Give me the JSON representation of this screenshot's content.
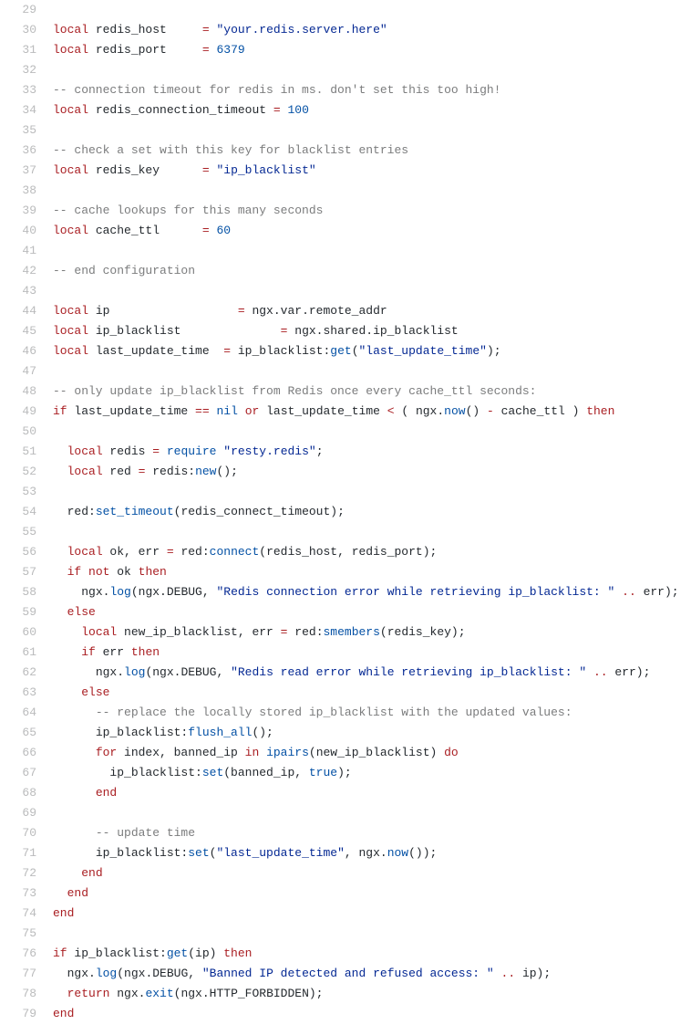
{
  "lines": [
    {
      "n": 29,
      "tokens": []
    },
    {
      "n": 30,
      "tokens": [
        {
          "c": "kw",
          "t": "local"
        },
        {
          "c": "pl",
          "t": " redis_host     "
        },
        {
          "c": "kw",
          "t": "="
        },
        {
          "c": "pl",
          "t": " "
        },
        {
          "c": "str",
          "t": "\"your.redis.server.here\""
        }
      ]
    },
    {
      "n": 31,
      "tokens": [
        {
          "c": "kw",
          "t": "local"
        },
        {
          "c": "pl",
          "t": " redis_port     "
        },
        {
          "c": "kw",
          "t": "="
        },
        {
          "c": "pl",
          "t": " "
        },
        {
          "c": "num",
          "t": "6379"
        }
      ]
    },
    {
      "n": 32,
      "tokens": []
    },
    {
      "n": 33,
      "tokens": [
        {
          "c": "com",
          "t": "-- connection timeout for redis in ms. don't set this too high!"
        }
      ]
    },
    {
      "n": 34,
      "tokens": [
        {
          "c": "kw",
          "t": "local"
        },
        {
          "c": "pl",
          "t": " redis_connection_timeout "
        },
        {
          "c": "kw",
          "t": "="
        },
        {
          "c": "pl",
          "t": " "
        },
        {
          "c": "num",
          "t": "100"
        }
      ]
    },
    {
      "n": 35,
      "tokens": []
    },
    {
      "n": 36,
      "tokens": [
        {
          "c": "com",
          "t": "-- check a set with this key for blacklist entries"
        }
      ]
    },
    {
      "n": 37,
      "tokens": [
        {
          "c": "kw",
          "t": "local"
        },
        {
          "c": "pl",
          "t": " redis_key      "
        },
        {
          "c": "kw",
          "t": "="
        },
        {
          "c": "pl",
          "t": " "
        },
        {
          "c": "str",
          "t": "\"ip_blacklist\""
        }
      ]
    },
    {
      "n": 38,
      "tokens": []
    },
    {
      "n": 39,
      "tokens": [
        {
          "c": "com",
          "t": "-- cache lookups for this many seconds"
        }
      ]
    },
    {
      "n": 40,
      "tokens": [
        {
          "c": "kw",
          "t": "local"
        },
        {
          "c": "pl",
          "t": " cache_ttl      "
        },
        {
          "c": "kw",
          "t": "="
        },
        {
          "c": "pl",
          "t": " "
        },
        {
          "c": "num",
          "t": "60"
        }
      ]
    },
    {
      "n": 41,
      "tokens": []
    },
    {
      "n": 42,
      "tokens": [
        {
          "c": "com",
          "t": "-- end configuration"
        }
      ]
    },
    {
      "n": 43,
      "tokens": []
    },
    {
      "n": 44,
      "tokens": [
        {
          "c": "kw",
          "t": "local"
        },
        {
          "c": "pl",
          "t": " ip                  "
        },
        {
          "c": "kw",
          "t": "="
        },
        {
          "c": "pl",
          "t": " ngx.var.remote_addr"
        }
      ]
    },
    {
      "n": 45,
      "tokens": [
        {
          "c": "kw",
          "t": "local"
        },
        {
          "c": "pl",
          "t": " ip_blacklist              "
        },
        {
          "c": "kw",
          "t": "="
        },
        {
          "c": "pl",
          "t": " ngx.shared.ip_blacklist"
        }
      ]
    },
    {
      "n": 46,
      "tokens": [
        {
          "c": "kw",
          "t": "local"
        },
        {
          "c": "pl",
          "t": " last_update_time  "
        },
        {
          "c": "kw",
          "t": "="
        },
        {
          "c": "pl",
          "t": " ip_blacklist:"
        },
        {
          "c": "fn",
          "t": "get"
        },
        {
          "c": "pl",
          "t": "("
        },
        {
          "c": "str",
          "t": "\"last_update_time\""
        },
        {
          "c": "pl",
          "t": ");"
        }
      ]
    },
    {
      "n": 47,
      "tokens": []
    },
    {
      "n": 48,
      "tokens": [
        {
          "c": "com",
          "t": "-- only update ip_blacklist from Redis once every cache_ttl seconds:"
        }
      ]
    },
    {
      "n": 49,
      "tokens": [
        {
          "c": "kw",
          "t": "if"
        },
        {
          "c": "pl",
          "t": " last_update_time "
        },
        {
          "c": "kw",
          "t": "=="
        },
        {
          "c": "pl",
          "t": " "
        },
        {
          "c": "bool",
          "t": "nil"
        },
        {
          "c": "pl",
          "t": " "
        },
        {
          "c": "kw",
          "t": "or"
        },
        {
          "c": "pl",
          "t": " last_update_time "
        },
        {
          "c": "kw",
          "t": "<"
        },
        {
          "c": "pl",
          "t": " ( ngx."
        },
        {
          "c": "fn",
          "t": "now"
        },
        {
          "c": "pl",
          "t": "() "
        },
        {
          "c": "kw",
          "t": "-"
        },
        {
          "c": "pl",
          "t": " cache_ttl ) "
        },
        {
          "c": "kw",
          "t": "then"
        }
      ]
    },
    {
      "n": 50,
      "tokens": []
    },
    {
      "n": 51,
      "indent": 2,
      "tokens": [
        {
          "c": "kw",
          "t": "local"
        },
        {
          "c": "pl",
          "t": " redis "
        },
        {
          "c": "kw",
          "t": "="
        },
        {
          "c": "pl",
          "t": " "
        },
        {
          "c": "fn",
          "t": "require"
        },
        {
          "c": "pl",
          "t": " "
        },
        {
          "c": "str",
          "t": "\"resty.redis\""
        },
        {
          "c": "pl",
          "t": ";"
        }
      ]
    },
    {
      "n": 52,
      "indent": 2,
      "tokens": [
        {
          "c": "kw",
          "t": "local"
        },
        {
          "c": "pl",
          "t": " red "
        },
        {
          "c": "kw",
          "t": "="
        },
        {
          "c": "pl",
          "t": " redis:"
        },
        {
          "c": "fn",
          "t": "new"
        },
        {
          "c": "pl",
          "t": "();"
        }
      ]
    },
    {
      "n": 53,
      "tokens": []
    },
    {
      "n": 54,
      "indent": 2,
      "tokens": [
        {
          "c": "pl",
          "t": "red:"
        },
        {
          "c": "fn",
          "t": "set_timeout"
        },
        {
          "c": "pl",
          "t": "(redis_connect_timeout);"
        }
      ]
    },
    {
      "n": 55,
      "tokens": []
    },
    {
      "n": 56,
      "indent": 2,
      "tokens": [
        {
          "c": "kw",
          "t": "local"
        },
        {
          "c": "pl",
          "t": " ok, err "
        },
        {
          "c": "kw",
          "t": "="
        },
        {
          "c": "pl",
          "t": " red:"
        },
        {
          "c": "fn",
          "t": "connect"
        },
        {
          "c": "pl",
          "t": "(redis_host, redis_port);"
        }
      ]
    },
    {
      "n": 57,
      "indent": 2,
      "tokens": [
        {
          "c": "kw",
          "t": "if"
        },
        {
          "c": "pl",
          "t": " "
        },
        {
          "c": "kw",
          "t": "not"
        },
        {
          "c": "pl",
          "t": " ok "
        },
        {
          "c": "kw",
          "t": "then"
        }
      ]
    },
    {
      "n": 58,
      "indent": 4,
      "tokens": [
        {
          "c": "pl",
          "t": "ngx."
        },
        {
          "c": "fn",
          "t": "log"
        },
        {
          "c": "pl",
          "t": "(ngx.DEBUG, "
        },
        {
          "c": "str",
          "t": "\"Redis connection error while retrieving ip_blacklist: \""
        },
        {
          "c": "pl",
          "t": " "
        },
        {
          "c": "kw",
          "t": ".."
        },
        {
          "c": "pl",
          "t": " err);"
        }
      ]
    },
    {
      "n": 59,
      "indent": 2,
      "tokens": [
        {
          "c": "kw",
          "t": "else"
        }
      ]
    },
    {
      "n": 60,
      "indent": 4,
      "tokens": [
        {
          "c": "kw",
          "t": "local"
        },
        {
          "c": "pl",
          "t": " new_ip_blacklist, err "
        },
        {
          "c": "kw",
          "t": "="
        },
        {
          "c": "pl",
          "t": " red:"
        },
        {
          "c": "fn",
          "t": "smembers"
        },
        {
          "c": "pl",
          "t": "(redis_key);"
        }
      ]
    },
    {
      "n": 61,
      "indent": 4,
      "tokens": [
        {
          "c": "kw",
          "t": "if"
        },
        {
          "c": "pl",
          "t": " err "
        },
        {
          "c": "kw",
          "t": "then"
        }
      ]
    },
    {
      "n": 62,
      "indent": 6,
      "tokens": [
        {
          "c": "pl",
          "t": "ngx."
        },
        {
          "c": "fn",
          "t": "log"
        },
        {
          "c": "pl",
          "t": "(ngx.DEBUG, "
        },
        {
          "c": "str",
          "t": "\"Redis read error while retrieving ip_blacklist: \""
        },
        {
          "c": "pl",
          "t": " "
        },
        {
          "c": "kw",
          "t": ".."
        },
        {
          "c": "pl",
          "t": " err);"
        }
      ]
    },
    {
      "n": 63,
      "indent": 4,
      "tokens": [
        {
          "c": "kw",
          "t": "else"
        }
      ]
    },
    {
      "n": 64,
      "indent": 6,
      "tokens": [
        {
          "c": "com",
          "t": "-- replace the locally stored ip_blacklist with the updated values:"
        }
      ]
    },
    {
      "n": 65,
      "indent": 6,
      "tokens": [
        {
          "c": "pl",
          "t": "ip_blacklist:"
        },
        {
          "c": "fn",
          "t": "flush_all"
        },
        {
          "c": "pl",
          "t": "();"
        }
      ]
    },
    {
      "n": 66,
      "indent": 6,
      "tokens": [
        {
          "c": "kw",
          "t": "for"
        },
        {
          "c": "pl",
          "t": " index, banned_ip "
        },
        {
          "c": "kw",
          "t": "in"
        },
        {
          "c": "pl",
          "t": " "
        },
        {
          "c": "fn",
          "t": "ipairs"
        },
        {
          "c": "pl",
          "t": "(new_ip_blacklist) "
        },
        {
          "c": "kw",
          "t": "do"
        }
      ]
    },
    {
      "n": 67,
      "indent": 8,
      "tokens": [
        {
          "c": "pl",
          "t": "ip_blacklist:"
        },
        {
          "c": "fn",
          "t": "set"
        },
        {
          "c": "pl",
          "t": "(banned_ip, "
        },
        {
          "c": "bool",
          "t": "true"
        },
        {
          "c": "pl",
          "t": ");"
        }
      ]
    },
    {
      "n": 68,
      "indent": 6,
      "tokens": [
        {
          "c": "kw",
          "t": "end"
        }
      ]
    },
    {
      "n": 69,
      "tokens": []
    },
    {
      "n": 70,
      "indent": 6,
      "tokens": [
        {
          "c": "com",
          "t": "-- update time"
        }
      ]
    },
    {
      "n": 71,
      "indent": 6,
      "tokens": [
        {
          "c": "pl",
          "t": "ip_blacklist:"
        },
        {
          "c": "fn",
          "t": "set"
        },
        {
          "c": "pl",
          "t": "("
        },
        {
          "c": "str",
          "t": "\"last_update_time\""
        },
        {
          "c": "pl",
          "t": ", ngx."
        },
        {
          "c": "fn",
          "t": "now"
        },
        {
          "c": "pl",
          "t": "());"
        }
      ]
    },
    {
      "n": 72,
      "indent": 4,
      "tokens": [
        {
          "c": "kw",
          "t": "end"
        }
      ]
    },
    {
      "n": 73,
      "indent": 2,
      "tokens": [
        {
          "c": "kw",
          "t": "end"
        }
      ]
    },
    {
      "n": 74,
      "tokens": [
        {
          "c": "kw",
          "t": "end"
        }
      ]
    },
    {
      "n": 75,
      "tokens": []
    },
    {
      "n": 76,
      "tokens": [
        {
          "c": "kw",
          "t": "if"
        },
        {
          "c": "pl",
          "t": " ip_blacklist:"
        },
        {
          "c": "fn",
          "t": "get"
        },
        {
          "c": "pl",
          "t": "(ip) "
        },
        {
          "c": "kw",
          "t": "then"
        }
      ]
    },
    {
      "n": 77,
      "indent": 2,
      "tokens": [
        {
          "c": "pl",
          "t": "ngx."
        },
        {
          "c": "fn",
          "t": "log"
        },
        {
          "c": "pl",
          "t": "(ngx.DEBUG, "
        },
        {
          "c": "str",
          "t": "\"Banned IP detected and refused access: \""
        },
        {
          "c": "pl",
          "t": " "
        },
        {
          "c": "kw",
          "t": ".."
        },
        {
          "c": "pl",
          "t": " ip);"
        }
      ]
    },
    {
      "n": 78,
      "indent": 2,
      "tokens": [
        {
          "c": "kw",
          "t": "return"
        },
        {
          "c": "pl",
          "t": " ngx."
        },
        {
          "c": "fn",
          "t": "exit"
        },
        {
          "c": "pl",
          "t": "(ngx.HTTP_FORBIDDEN);"
        }
      ]
    },
    {
      "n": 79,
      "tokens": [
        {
          "c": "kw",
          "t": "end"
        }
      ]
    }
  ]
}
